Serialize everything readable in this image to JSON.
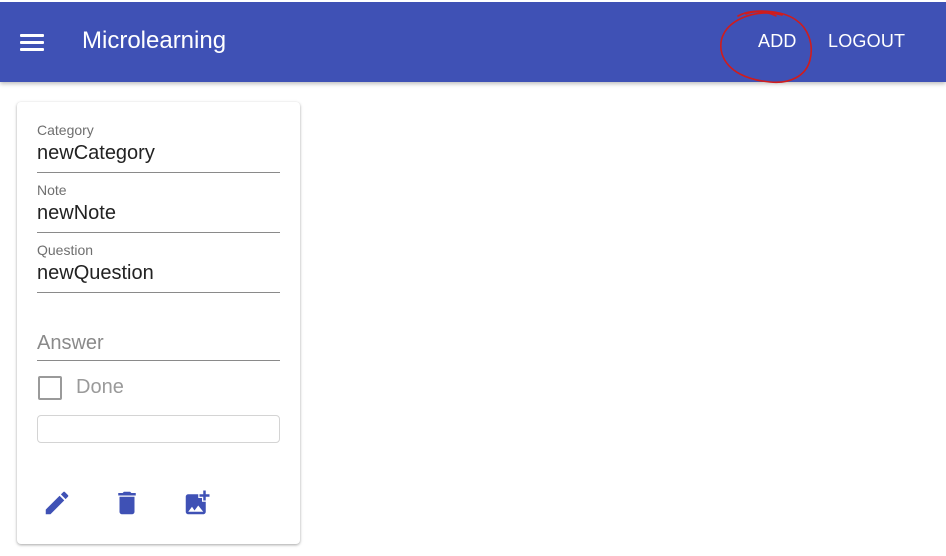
{
  "appbar": {
    "title": "Microlearning",
    "add_label": "ADD",
    "logout_label": "LOGOUT",
    "background_color": "#3f51b5",
    "menu_icon": "menu-icon"
  },
  "card": {
    "category": {
      "label": "Category",
      "value": "newCategory"
    },
    "note": {
      "label": "Note",
      "value": "newNote"
    },
    "question": {
      "label": "Question",
      "value": "newQuestion"
    },
    "answer": {
      "placeholder": "Answer",
      "value": ""
    },
    "done": {
      "label": "Done",
      "checked": false
    },
    "extra_input": {
      "value": ""
    },
    "actions": [
      {
        "icon": "edit-icon"
      },
      {
        "icon": "delete-icon"
      },
      {
        "icon": "add-image-icon"
      }
    ],
    "accent_color": "#3f51b5"
  },
  "annotation": {
    "color": "#d01c1c"
  }
}
